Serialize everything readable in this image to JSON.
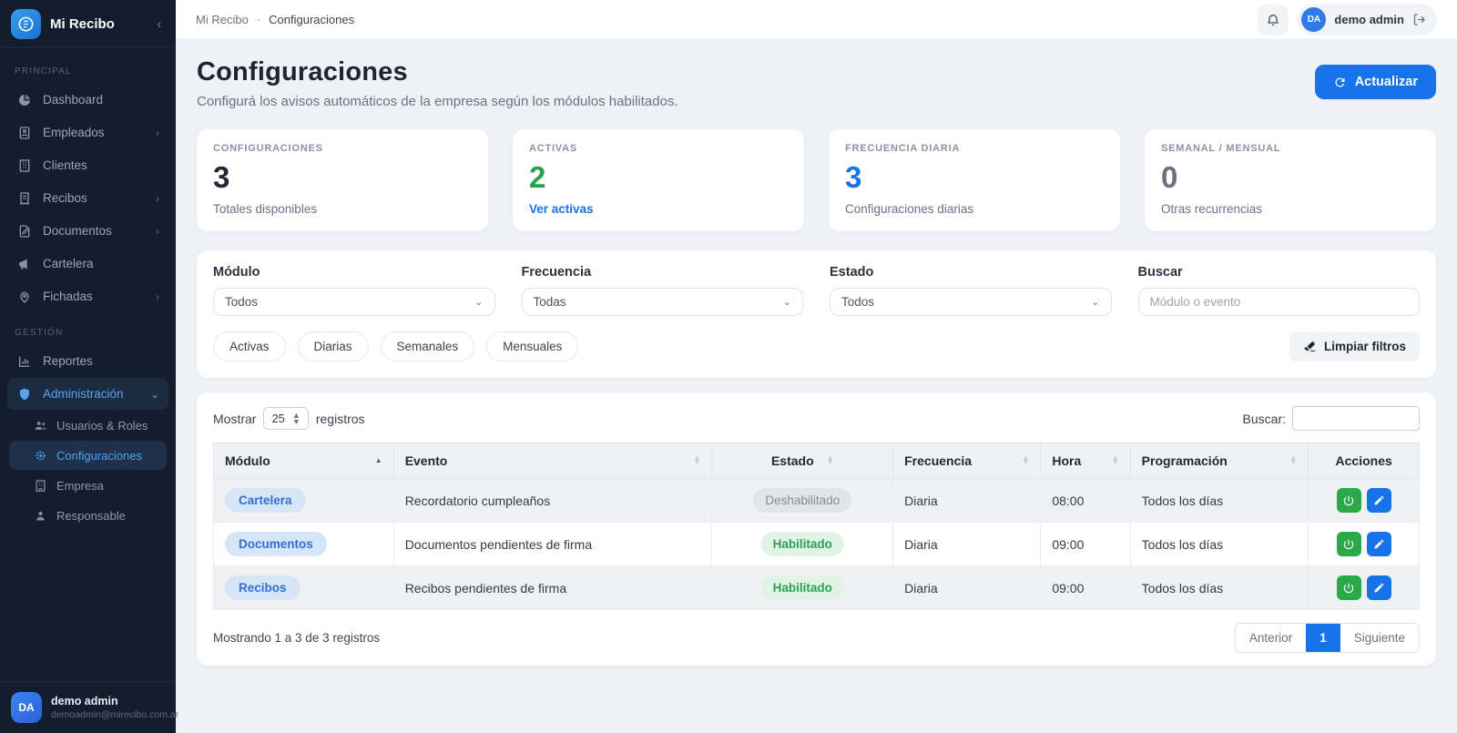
{
  "brand": {
    "name": "Mi Recibo"
  },
  "sidebar": {
    "sections": [
      {
        "label": "PRINCIPAL",
        "items": [
          {
            "label": "Dashboard"
          },
          {
            "label": "Empleados"
          },
          {
            "label": "Clientes"
          },
          {
            "label": "Recibos"
          },
          {
            "label": "Documentos"
          },
          {
            "label": "Cartelera"
          },
          {
            "label": "Fichadas"
          }
        ]
      },
      {
        "label": "GESTIÓN",
        "items": [
          {
            "label": "Reportes"
          },
          {
            "label": "Administración",
            "children": [
              {
                "label": "Usuarios & Roles"
              },
              {
                "label": "Configuraciones"
              },
              {
                "label": "Empresa"
              },
              {
                "label": "Responsable"
              }
            ]
          }
        ]
      }
    ],
    "user": {
      "avatar": "DA",
      "name": "demo admin",
      "email": "demoadmin@mirecibo.com.ar"
    }
  },
  "header": {
    "breadcrumb": {
      "app": "Mi Recibo",
      "separator": "·",
      "page": "Configuraciones"
    },
    "user": {
      "avatar": "DA",
      "name": "demo admin"
    }
  },
  "page": {
    "title": "Configuraciones",
    "subtitle": "Configurá los avisos automáticos de la empresa según los módulos habilitados.",
    "refresh_label": "Actualizar"
  },
  "stats": [
    {
      "label": "CONFIGURACIONES",
      "value": "3",
      "caption": "Totales disponibles",
      "value_color": "#1f2937"
    },
    {
      "label": "ACTIVAS",
      "value": "2",
      "caption": "Ver activas",
      "value_color": "#27a24a",
      "caption_color": "#1673e8"
    },
    {
      "label": "FRECUENCIA DIARIA",
      "value": "3",
      "caption": "Configuraciones diarias",
      "value_color": "#1673e8"
    },
    {
      "label": "SEMANAL / MENSUAL",
      "value": "0",
      "caption": "Otras recurrencias",
      "value_color": "#6b7280"
    }
  ],
  "filters": {
    "module_label": "Módulo",
    "module_value": "Todos",
    "frequency_label": "Frecuencia",
    "frequency_value": "Todas",
    "status_label": "Estado",
    "status_value": "Todos",
    "search_label": "Buscar",
    "search_placeholder": "Módulo o evento",
    "pills": [
      "Activas",
      "Diarias",
      "Semanales",
      "Mensuales"
    ],
    "clear_label": "Limpiar filtros"
  },
  "table": {
    "show_label": "Mostrar",
    "page_size": "25",
    "records_label": "registros",
    "search_label": "Buscar:",
    "columns": [
      "Módulo",
      "Evento",
      "Estado",
      "Frecuencia",
      "Hora",
      "Programación",
      "Acciones"
    ],
    "rows": [
      {
        "module": "Cartelera",
        "event": "Recordatorio cumpleaños",
        "status": "Deshabilitado",
        "frequency": "Diaria",
        "time": "08:00",
        "schedule": "Todos los días"
      },
      {
        "module": "Documentos",
        "event": "Documentos pendientes de firma",
        "status": "Habilitado",
        "frequency": "Diaria",
        "time": "09:00",
        "schedule": "Todos los días"
      },
      {
        "module": "Recibos",
        "event": "Recibos pendientes de firma",
        "status": "Habilitado",
        "frequency": "Diaria",
        "time": "09:00",
        "schedule": "Todos los días"
      }
    ],
    "footer_text": "Mostrando 1 a 3 de 3 registros",
    "pagination": {
      "prev": "Anterior",
      "page": "1",
      "next": "Siguiente"
    }
  },
  "colors": {
    "primary": "#1673e8",
    "success": "#2ba84a",
    "sidebar_bg": "#141d2e",
    "page_bg": "#eef1f6"
  }
}
